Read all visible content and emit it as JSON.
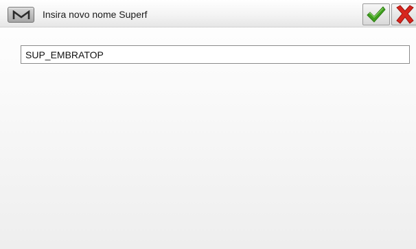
{
  "header": {
    "menu_icon": "m-logo-icon",
    "title": "Insira novo nome Superf",
    "confirm_icon": "checkmark-icon",
    "cancel_icon": "close-icon"
  },
  "form": {
    "name_value": "SUP_EMBRATOP"
  },
  "colors": {
    "confirm": "#3f9f1f",
    "cancel": "#d7261e"
  }
}
